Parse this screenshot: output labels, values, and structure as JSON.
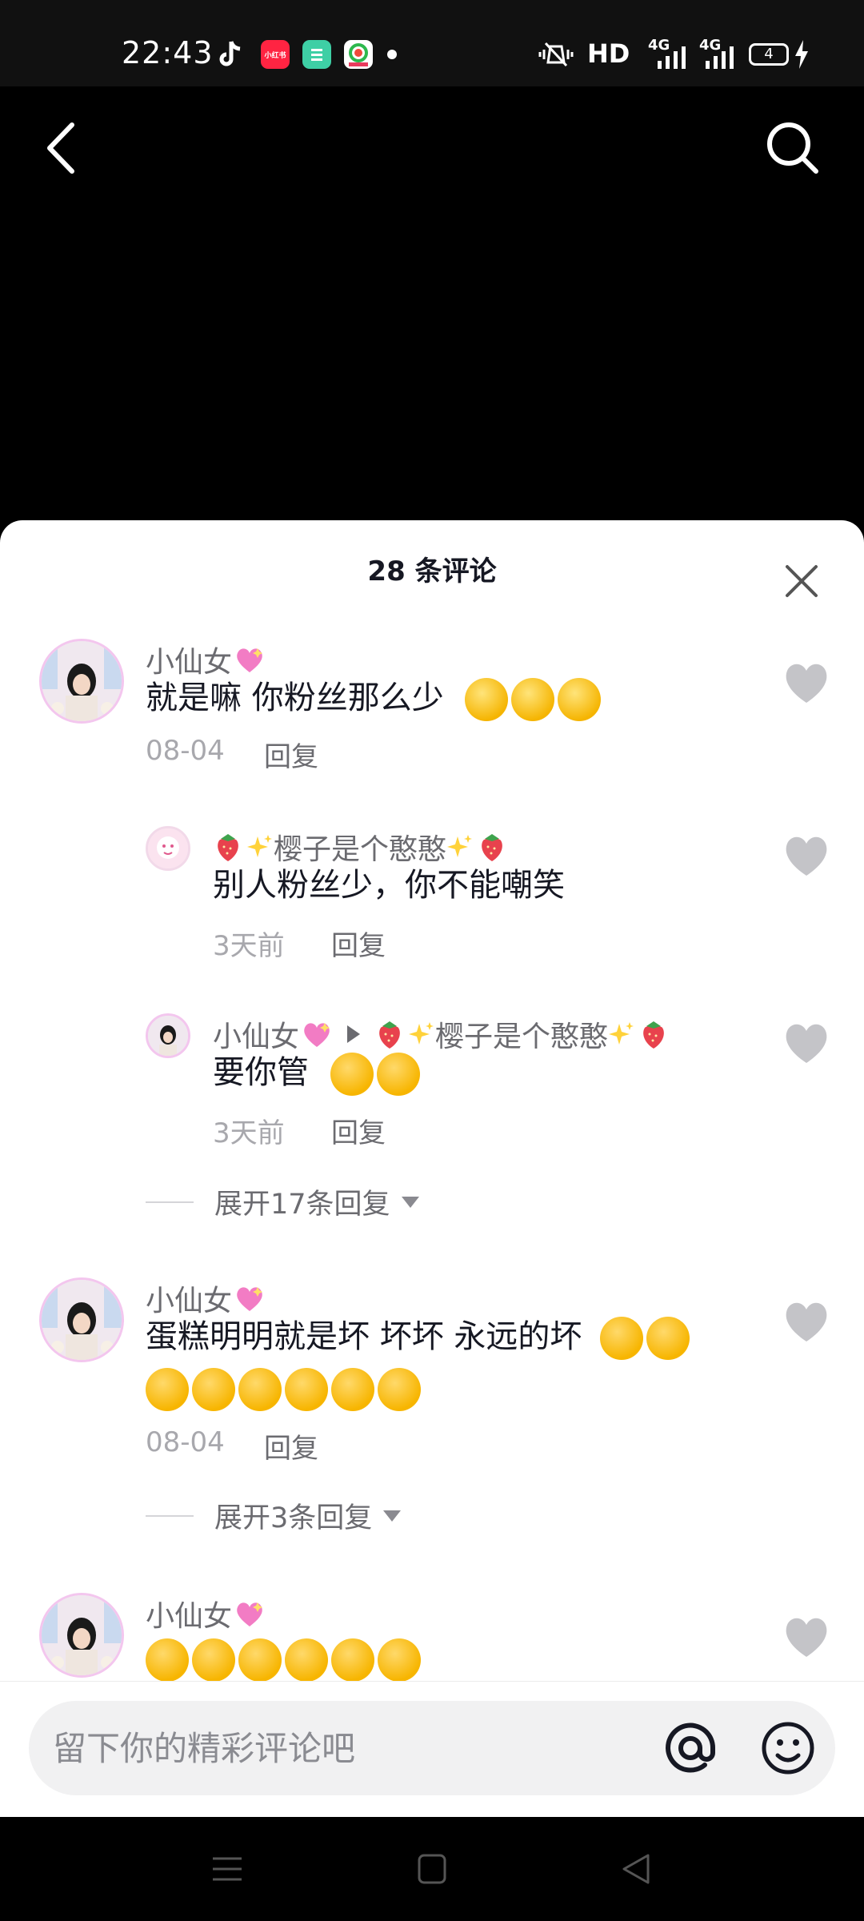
{
  "status_bar": {
    "time": "22:43",
    "hd": "HD",
    "net1": "4G",
    "net2": "4G",
    "battery": "4",
    "app_icons": [
      "tiktok-icon",
      "xiaohongshu-icon",
      "green-app-icon",
      "colorful-app-icon"
    ],
    "xiaohongshu_label": "小红书"
  },
  "header": {
    "back_icon": "back-arrow-icon",
    "search_icon": "search-icon"
  },
  "comments_sheet": {
    "title": "28 条评论",
    "close_icon": "close-icon",
    "comments": [
      {
        "user": "小仙女",
        "text": "就是嘛 你粉丝那么少",
        "time": "08-04",
        "reply": "回复",
        "replies": [
          {
            "user": "樱子是个憨憨",
            "text": "别人粉丝少，你不能嘲笑",
            "time": "3天前",
            "reply": "回复"
          },
          {
            "user": "小仙女",
            "reply_to": "樱子是个憨憨",
            "text": "要你管",
            "time": "3天前",
            "reply": "回复"
          }
        ],
        "expand": "展开17条回复"
      },
      {
        "user": "小仙女",
        "text": "蛋糕明明就是坏 坏坏 永远的坏",
        "time": "08-04",
        "reply": "回复",
        "expand": "展开3条回复"
      },
      {
        "user": "小仙女"
      }
    ]
  },
  "input": {
    "placeholder": "留下你的精彩评论吧",
    "value": ""
  },
  "colors": {
    "sheet_bg": "#ffffff",
    "text_primary": "#161823",
    "text_secondary": "#6b6b70",
    "text_muted": "#a8a8ad",
    "heart_gray": "#c4c4c8"
  }
}
